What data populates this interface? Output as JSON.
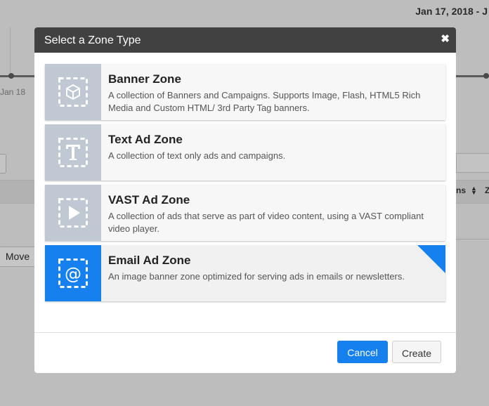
{
  "background": {
    "date_range": "Jan 17, 2018 - J",
    "x_axis_label": "Jan 18",
    "move_button": "Move",
    "column_header": "ns",
    "column_header_2": "Z"
  },
  "modal": {
    "title": "Select a Zone Type",
    "close_icon": "close-icon",
    "zones": [
      {
        "title": "Banner Zone",
        "description": "A collection of Banners and Campaigns. Supports Image, Flash, HTML5 Rich Media and Custom HTML/ 3rd Party Tag banners.",
        "icon": "cube-icon",
        "selected": false
      },
      {
        "title": "Text Ad Zone",
        "description": "A collection of text only ads and campaigns.",
        "icon": "text-icon",
        "selected": false
      },
      {
        "title": "VAST Ad Zone",
        "description": "A collection of ads that serve as part of video content, using a VAST compliant video player.",
        "icon": "play-icon",
        "selected": false
      },
      {
        "title": "Email Ad Zone",
        "description": "An image banner zone optimized for serving ads in emails or newsletters.",
        "icon": "at-sign-icon",
        "selected": true
      }
    ],
    "footer": {
      "cancel_label": "Cancel",
      "create_label": "Create"
    }
  },
  "colors": {
    "accent": "#1680ef",
    "header": "#414141",
    "icon_tile": "#c0c8d3",
    "overlay": "#bdbdbd"
  }
}
